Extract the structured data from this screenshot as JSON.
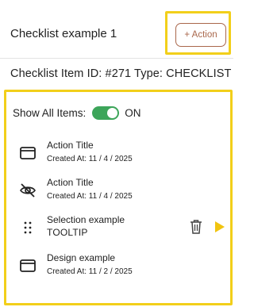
{
  "header": {
    "title": "Checklist example 1",
    "action_label": "+ Action"
  },
  "subtitle": "Checklist Item ID: #271 Type: CHECKLIST",
  "toggle": {
    "label": "Show All Items:",
    "state": "ON",
    "checked": true
  },
  "items": [
    {
      "icon": "window-icon",
      "title": "Action Title",
      "meta": "Created At: 11 / 4 / 2025"
    },
    {
      "icon": "eye-off-icon",
      "title": "Action Title",
      "meta": "Created At: 11 / 4 / 2025"
    },
    {
      "icon": "drag-handle-icon",
      "title": "Selection example",
      "meta": "TOOLTIP"
    },
    {
      "icon": "window-icon",
      "title": "Design example",
      "meta": "Created At: 11 / 2 / 2025"
    }
  ],
  "colors": {
    "accent_highlight": "#f2cf1a",
    "action_brown": "#a9674b",
    "toggle_green": "#3da55a",
    "play_yellow": "#f1c40f"
  }
}
